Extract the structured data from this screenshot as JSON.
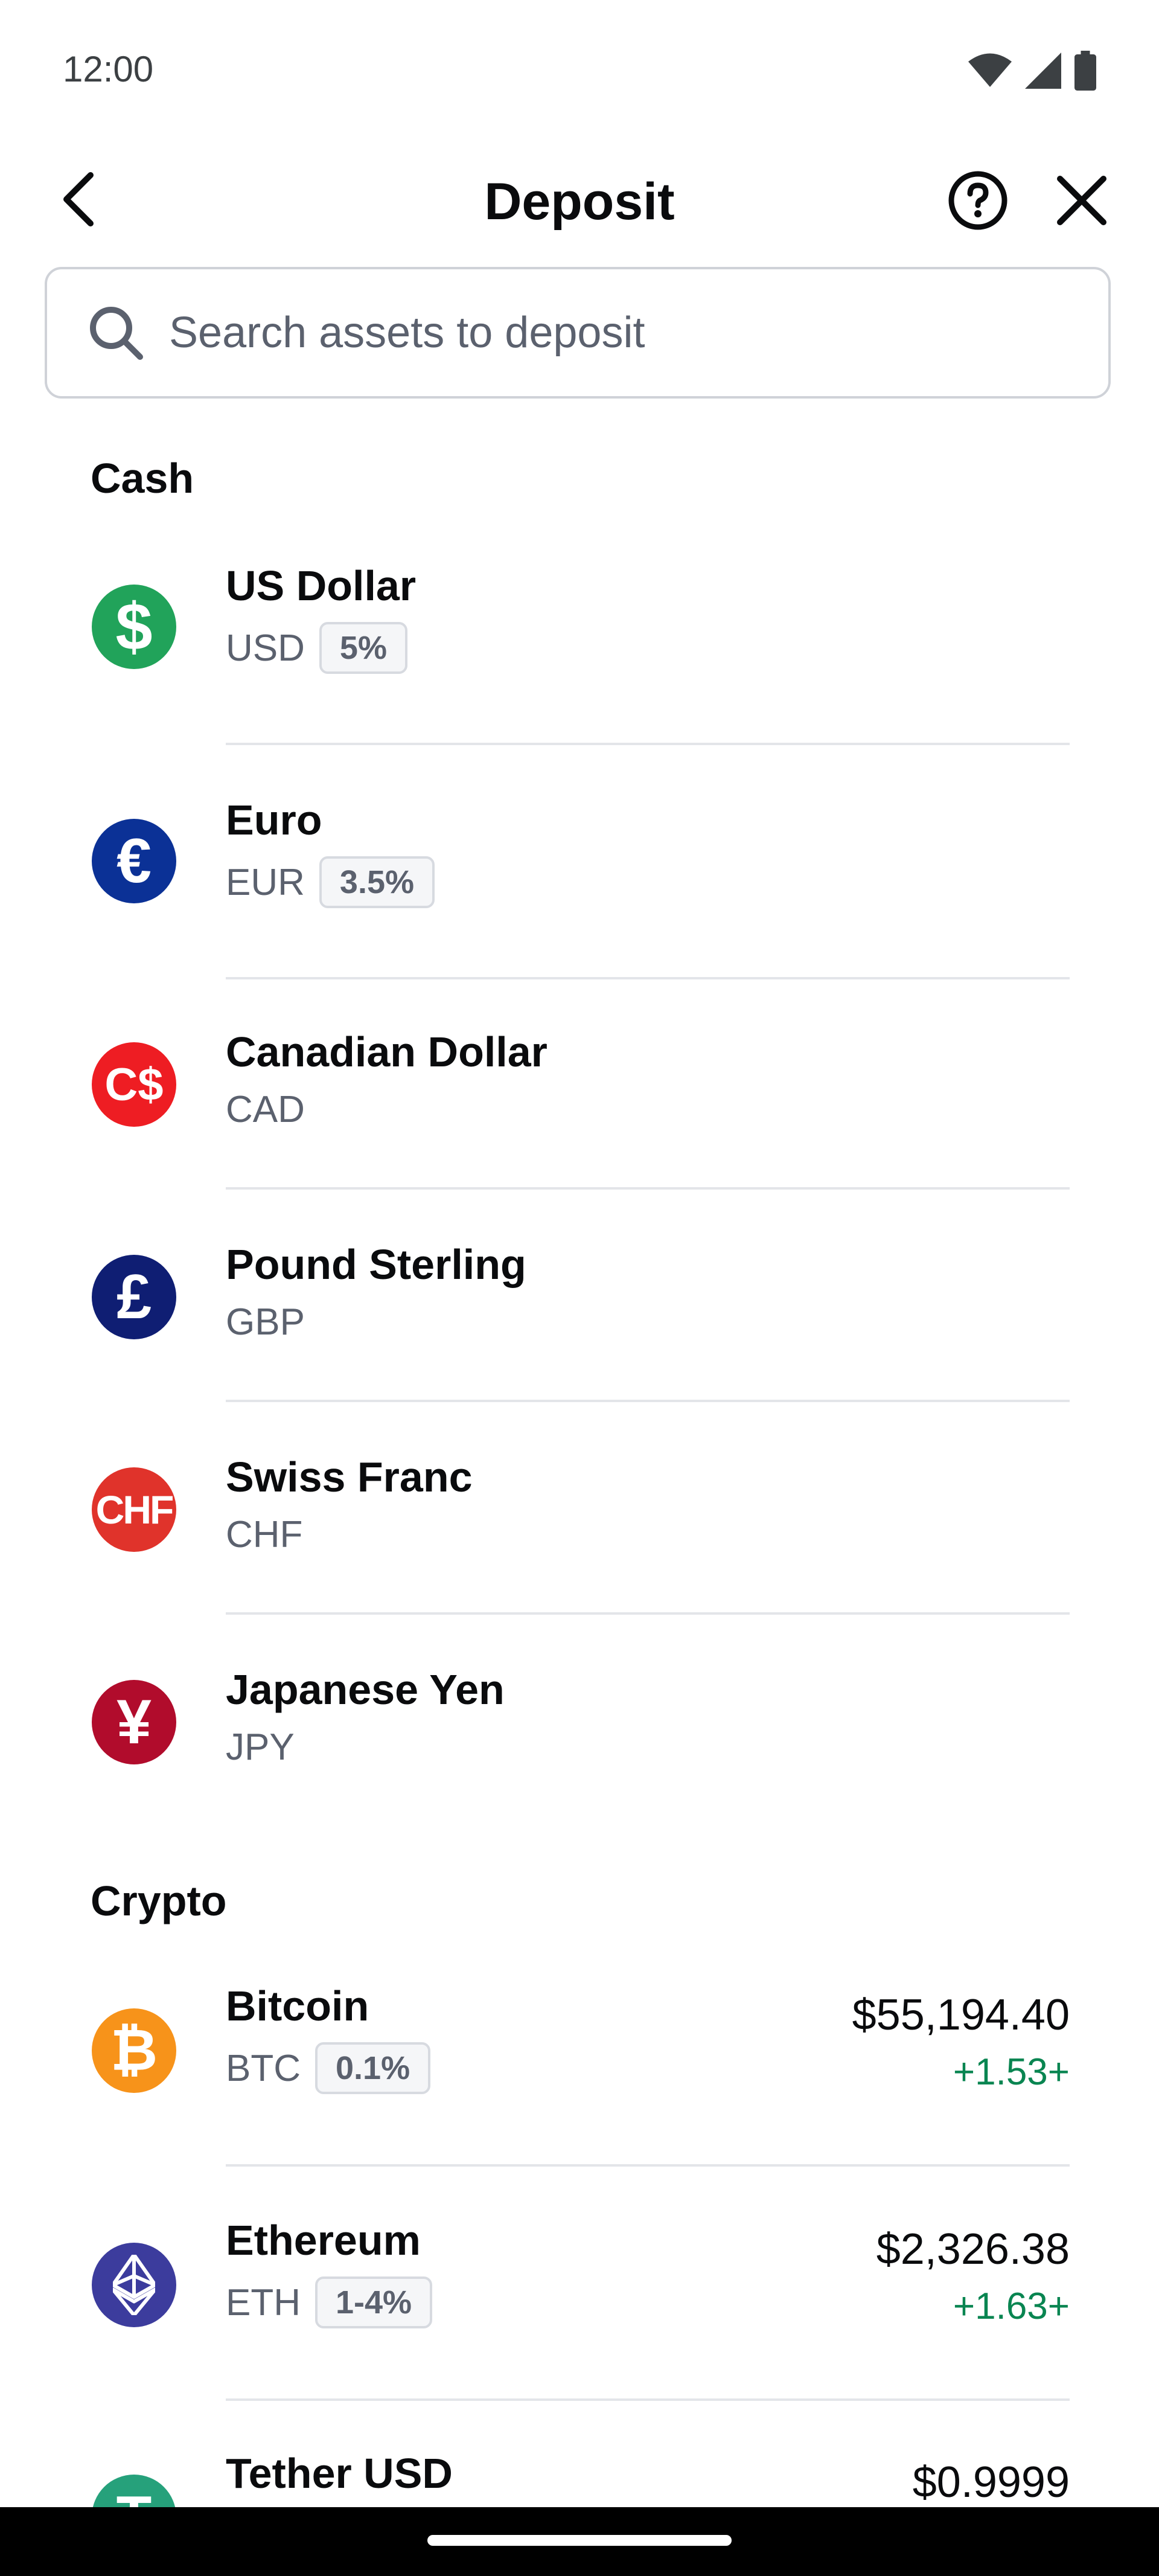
{
  "status_bar": {
    "time": "12:00",
    "icons": [
      "wifi-icon",
      "signal-icon",
      "battery-icon"
    ]
  },
  "header": {
    "title": "Deposit"
  },
  "search": {
    "placeholder": "Search assets to deposit"
  },
  "colors": {
    "positive": "#098551",
    "usd": "#21a35a",
    "eur": "#0b3196",
    "cad": "#ee1d23",
    "gbp": "#0f1e73",
    "chf": "#e0332b",
    "jpy": "#b10c2c",
    "btc": "#f7931a",
    "eth": "#3c3c9d",
    "usdt": "#26a17b"
  },
  "cash": {
    "title": "Cash",
    "items": [
      {
        "name": "US Dollar",
        "code": "USD",
        "badge": "5%",
        "icon": "dollar-icon",
        "glyph": "$"
      },
      {
        "name": "Euro",
        "code": "EUR",
        "badge": "3.5%",
        "icon": "euro-icon",
        "glyph": "€"
      },
      {
        "name": "Canadian Dollar",
        "code": "CAD",
        "icon": "canadian-dollar-icon",
        "glyph": "C$"
      },
      {
        "name": "Pound Sterling",
        "code": "GBP",
        "icon": "pound-icon",
        "glyph": "£"
      },
      {
        "name": "Swiss Franc",
        "code": "CHF",
        "icon": "swiss-franc-icon",
        "glyph": "CHF"
      },
      {
        "name": "Japanese Yen",
        "code": "JPY",
        "icon": "yen-icon",
        "glyph": "¥"
      }
    ]
  },
  "crypto": {
    "title": "Crypto",
    "items": [
      {
        "name": "Bitcoin",
        "code": "BTC",
        "badge": "0.1%",
        "price": "$55,194.40",
        "change": "+1.53+",
        "icon": "bitcoin-icon",
        "glyph": "₿"
      },
      {
        "name": "Ethereum",
        "code": "ETH",
        "badge": "1-4%",
        "price": "$2,326.38",
        "change": "+1.63+",
        "icon": "ethereum-icon"
      },
      {
        "name": "Tether USD",
        "price": "$0.9999",
        "icon": "tether-icon",
        "glyph": "T"
      }
    ]
  }
}
